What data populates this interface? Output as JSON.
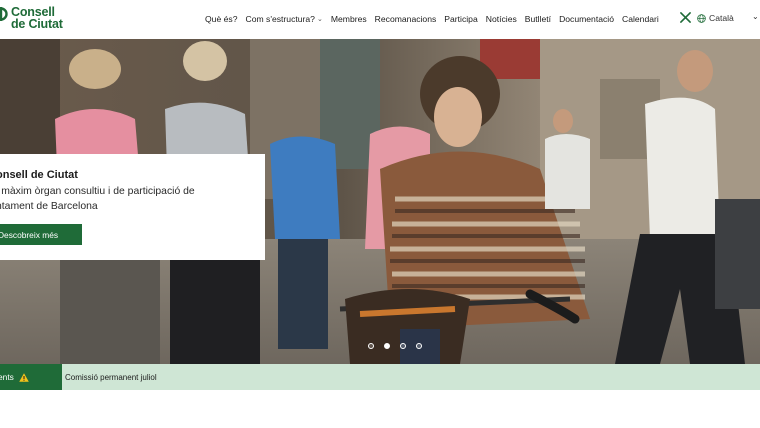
{
  "brand": {
    "line1": "Consell",
    "line2": "de Ciutat",
    "color": "#1f6b38"
  },
  "nav": {
    "items": [
      {
        "label": "Què és?",
        "dropdown": false
      },
      {
        "label": "Com s'estructura?",
        "dropdown": true
      },
      {
        "label": "Membres",
        "dropdown": false
      },
      {
        "label": "Recomanacions",
        "dropdown": false
      },
      {
        "label": "Participa",
        "dropdown": false
      },
      {
        "label": "Notícies",
        "dropdown": false
      },
      {
        "label": "Butlletí",
        "dropdown": false
      },
      {
        "label": "Documentació",
        "dropdown": false
      },
      {
        "label": "Calendari",
        "dropdown": false
      }
    ],
    "social_icon": "x-icon",
    "language": "Català",
    "language_icon": "globe-icon"
  },
  "hero": {
    "title": "onsell de Ciutat",
    "description": "l màxim òrgan consultiu i de participació de ntament de Barcelona",
    "cta_label": "Descobreix més",
    "slides_count": 4,
    "active_slide": 1
  },
  "news": {
    "tag_label": "ents",
    "tag_icon": "warning-icon",
    "headline": "Comissió permanent juliol"
  },
  "colors": {
    "accent": "#1f6b38",
    "news_bar_bg": "#cfe6d5"
  }
}
